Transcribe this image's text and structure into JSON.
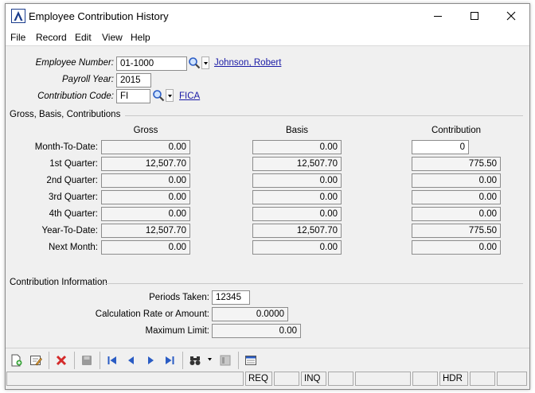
{
  "window": {
    "title": "Employee Contribution History"
  },
  "menu": [
    "File",
    "Record",
    "Edit",
    "View",
    "Help"
  ],
  "employee": {
    "number_label": "Employee Number:",
    "number": "01-1000",
    "name": "Johnson, Robert",
    "year_label": "Payroll Year:",
    "year": "2015",
    "code_label": "Contribution Code:",
    "code": "FI",
    "code_desc": "FICA"
  },
  "gbc": {
    "title": "Gross, Basis,  Contributions",
    "headers": {
      "gross": "Gross",
      "basis": "Basis",
      "contribution": "Contribution"
    },
    "rows": [
      {
        "label": "Month-To-Date:",
        "gross": "0.00",
        "basis": "0.00",
        "contribution": "0"
      },
      {
        "label": "1st Quarter:",
        "gross": "12,507.70",
        "basis": "12,507.70",
        "contribution": "775.50"
      },
      {
        "label": "2nd Quarter:",
        "gross": "0.00",
        "basis": "0.00",
        "contribution": "0.00"
      },
      {
        "label": "3rd Quarter:",
        "gross": "0.00",
        "basis": "0.00",
        "contribution": "0.00"
      },
      {
        "label": "4th Quarter:",
        "gross": "0.00",
        "basis": "0.00",
        "contribution": "0.00"
      },
      {
        "label": "Year-To-Date:",
        "gross": "12,507.70",
        "basis": "12,507.70",
        "contribution": "775.50"
      },
      {
        "label": "Next Month:",
        "gross": "0.00",
        "basis": "0.00",
        "contribution": "0.00"
      }
    ]
  },
  "info": {
    "title": "Contribution Information",
    "periods_label": "Periods Taken:",
    "periods": "12345",
    "rate_label": "Calculation Rate or Amount:",
    "rate": "0.0000",
    "max_label": "Maximum Limit:",
    "max": "0.00"
  },
  "status": {
    "panels": [
      "",
      "REQ",
      "",
      "INQ",
      "",
      "",
      "HDR",
      "",
      ""
    ]
  },
  "icons": {
    "lookup": "magnifier-icon",
    "new": "new-record-icon",
    "edit": "edit-record-icon",
    "delete": "delete-icon",
    "save": "save-icon",
    "first": "first-record-icon",
    "prev": "previous-record-icon",
    "next": "next-record-icon",
    "last": "last-record-icon",
    "find": "binoculars-icon",
    "layout": "layout-icon"
  },
  "colors": {
    "link": "#1a1aa6",
    "delete": "#d42a2a",
    "nav": "#2a5cc4"
  }
}
